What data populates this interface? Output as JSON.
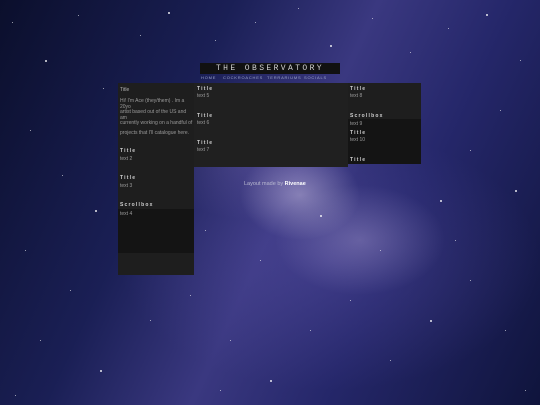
{
  "header": {
    "title": "THE OBSERVATORY"
  },
  "nav": {
    "items": [
      "HOME",
      "COCKROACHES",
      "TERRARIUMS",
      "SOCIALS"
    ]
  },
  "left": {
    "title": "Title",
    "intro": [
      "Hi! I'm Ace (they/them) . Im a 20yo",
      "artist based out of the US and am",
      "currently working on a handful of",
      "projects that I'll catalogue here."
    ],
    "sections": [
      {
        "title": "Title",
        "text": "text 2"
      },
      {
        "title": "Title",
        "text": "text 3"
      }
    ],
    "scrollbox": {
      "title": "Scrollbox",
      "text": "text 4"
    }
  },
  "middle": {
    "sections": [
      {
        "title": "Title",
        "text": "text 5"
      },
      {
        "title": "Title",
        "text": "text 6"
      },
      {
        "title": "Title",
        "text": "text 7"
      }
    ]
  },
  "right": {
    "section1": {
      "title": "Title",
      "text": "text 8"
    },
    "scrollbox": {
      "title": "Scrollbox",
      "text": "text 9"
    },
    "section2": {
      "title": "Title",
      "text": "text 10"
    },
    "section3": {
      "title": "Title"
    }
  },
  "credit": {
    "prefix": "Layout made by ",
    "author": "Rivenae"
  }
}
